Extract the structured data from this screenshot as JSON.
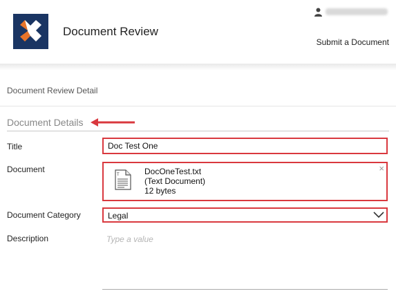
{
  "header": {
    "app_title": "Document Review",
    "submit_link": "Submit a Document"
  },
  "page": {
    "subheader": "Document Review Detail",
    "section_title": "Document Details"
  },
  "form": {
    "title": {
      "label": "Title",
      "value": "Doc Test One"
    },
    "document": {
      "label": "Document",
      "file_name": "DocOneTest.txt",
      "file_type": "(Text Document)",
      "file_size": "12 bytes",
      "close_glyph": "×"
    },
    "category": {
      "label": "Document Category",
      "value": "Legal"
    },
    "description": {
      "label": "Description",
      "placeholder": "Type a value"
    }
  },
  "colors": {
    "logo_bg": "#1a3563",
    "logo_accent": "#e8742a",
    "highlight": "#d9383e"
  },
  "icons": {
    "logo": "nintex-x-logo",
    "user": "user-icon",
    "arrow": "arrow-left-icon",
    "file": "text-file-icon",
    "close": "close-icon",
    "dropdown": "chevron-down-icon"
  }
}
